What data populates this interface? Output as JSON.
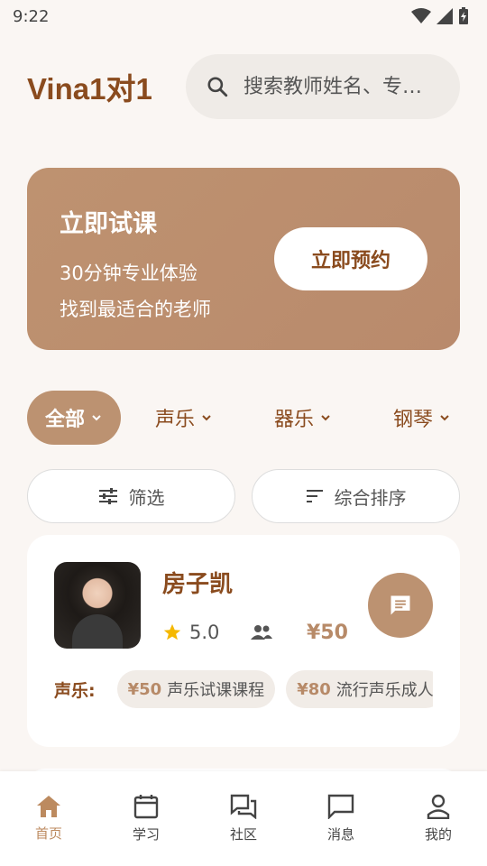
{
  "status": {
    "time": "9:22"
  },
  "header": {
    "brand": "Vina1对1",
    "search_placeholder": "搜索教师姓名、专…"
  },
  "banner": {
    "title": "立即试课",
    "line1": "30分钟专业体验",
    "line2": "找到最适合的老师",
    "button": "立即预约"
  },
  "categories": [
    {
      "label": "全部",
      "active": true
    },
    {
      "label": "声乐"
    },
    {
      "label": "器乐"
    },
    {
      "label": "钢琴"
    }
  ],
  "filters": {
    "filter_label": "筛选",
    "sort_label": "综合排序"
  },
  "teacher": {
    "name": "房子凯",
    "rating": "5.0",
    "price": "¥50",
    "course_label": "声乐:",
    "courses": [
      {
        "price": "¥50",
        "name": "声乐试课课程"
      },
      {
        "price": "¥80",
        "name": "流行声乐成人"
      }
    ]
  },
  "tabs": [
    {
      "label": "首页",
      "icon": "home-icon",
      "active": true
    },
    {
      "label": "学习",
      "icon": "calendar-icon"
    },
    {
      "label": "社区",
      "icon": "forum-icon"
    },
    {
      "label": "消息",
      "icon": "message-icon"
    },
    {
      "label": "我的",
      "icon": "person-icon"
    }
  ],
  "colors": {
    "accent": "#bc9271",
    "brand": "#8a4b1e",
    "background": "#faf6f3"
  }
}
